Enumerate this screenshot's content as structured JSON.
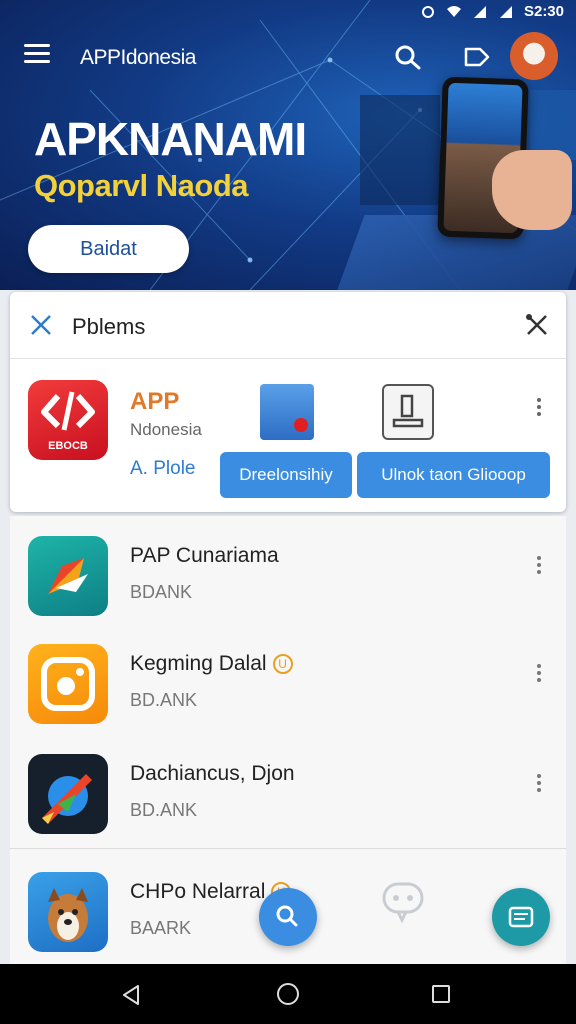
{
  "status_bar": {
    "time": "S2:30",
    "icons": [
      "alarm-icon",
      "wifi-icon",
      "signal-icon",
      "signal-icon"
    ]
  },
  "app_bar": {
    "title": "APPIdonesia",
    "icons": [
      "menu-icon",
      "search-icon",
      "tag-icon",
      "avatar"
    ]
  },
  "hero": {
    "title": "APKNANAMI",
    "subtitle": "Qoparvl Naoda",
    "button_label": "Baidat",
    "colors": {
      "background": "#123b86",
      "title": "#ffffff",
      "subtitle": "#f3d13a"
    }
  },
  "panel": {
    "title": "Pblems",
    "featured": {
      "icon_label": "EBOCB",
      "name": "APP",
      "subtitle": "Ndonesia",
      "link": "A. Plole",
      "button_primary": "Dreelonsihiy",
      "button_secondary": "Ulnok taon Gliooop"
    }
  },
  "list": {
    "items": [
      {
        "name": "PAP Cunariama",
        "meta": "BDANK",
        "icon": "kite-arrow-icon",
        "badge": ""
      },
      {
        "name": "Kegming Dalal",
        "meta": "BD.ANK",
        "icon": "camera-app-icon",
        "badge": "U"
      },
      {
        "name": "Dachiancus, Djon",
        "meta": "BD.ANK",
        "icon": "pen-arrow-icon",
        "badge": ""
      },
      {
        "name": "CHPo Nelarral",
        "meta": "BAARK",
        "icon": "dog-app-icon",
        "badge": "U"
      }
    ]
  },
  "fab": {
    "search": "search-icon",
    "chat": "chat-icon"
  },
  "colors": {
    "accent": "#3a8de0",
    "teal": "#1e9aa6",
    "badge": "#e8a020"
  }
}
